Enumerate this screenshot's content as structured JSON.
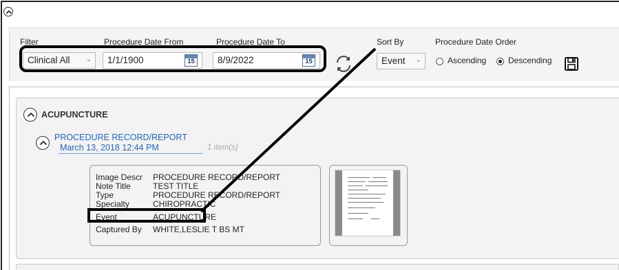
{
  "filter": {
    "filter_label": "Filter",
    "filter_value": "Clinical All",
    "date_from_label": "Procedure Date From",
    "date_from_value": "1/1/1900",
    "date_to_label": "Procedure Date To",
    "date_to_value": "8/9/2022",
    "calendar_day": "15",
    "sort_by_label": "Sort By",
    "sort_by_value": "Event",
    "order_label": "Procedure Date Order",
    "order_options": [
      "Ascending",
      "Descending"
    ],
    "order_selected": "Descending"
  },
  "section": {
    "title": "ACUPUNCTURE",
    "record": {
      "title": "PROCEDURE RECORD/REPORT",
      "date": "March 13, 2018 12:44 PM",
      "count": "1 item(s)",
      "details": [
        {
          "key": "Image Descr",
          "value": "PROCEDURE RECORD/REPORT"
        },
        {
          "key": "Note Title",
          "value": "TEST TITLE"
        },
        {
          "key": "Type",
          "value": "PROCEDURE RECORD/REPORT"
        },
        {
          "key": "Specialty",
          "value": "CHIROPRACTIC"
        },
        {
          "key": "Event",
          "value": "ACUPUNCTURE"
        },
        {
          "key": "Captured By",
          "value": "WHITE,LESLIE T BS MT"
        }
      ]
    }
  },
  "colors": {
    "link": "#2266bb",
    "annotation": "#000000",
    "panel": "#f3f3f3"
  },
  "icons": [
    "chevron-up-icon",
    "calendar-icon",
    "refresh-icon",
    "save-icon",
    "dropdown-arrow-icon"
  ]
}
